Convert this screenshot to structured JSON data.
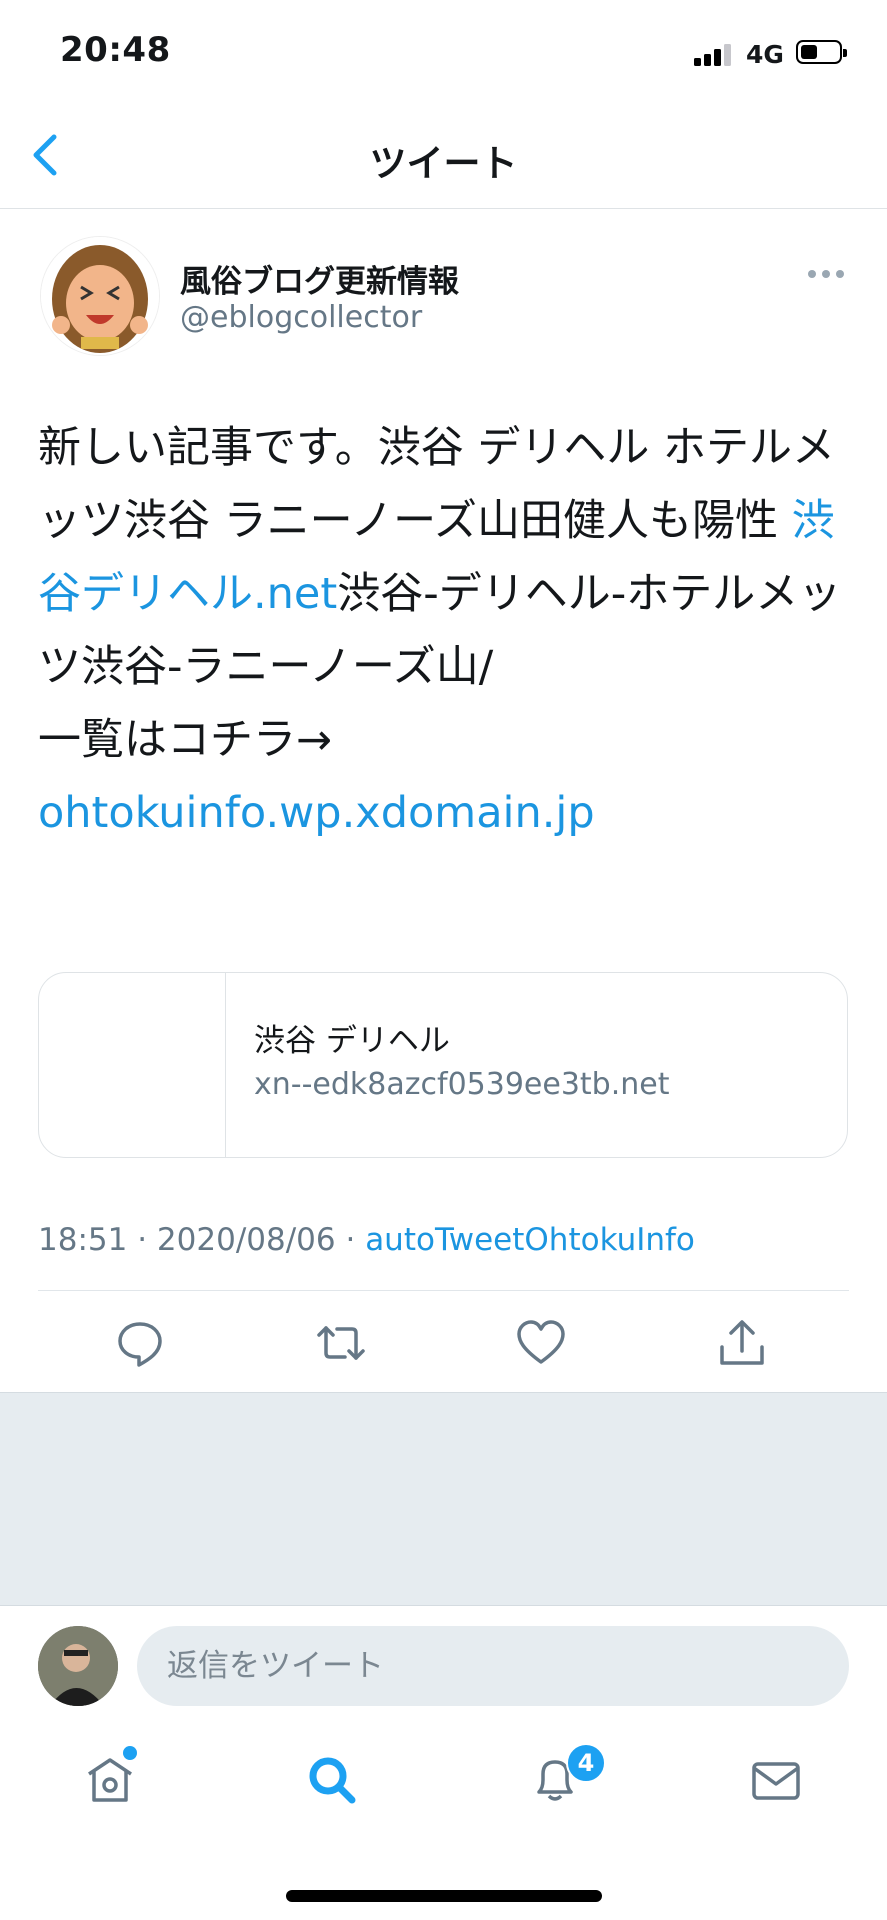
{
  "status_bar": {
    "time": "20:48",
    "network": "4G",
    "battery_level": 0.45
  },
  "header": {
    "title": "ツイート"
  },
  "tweet": {
    "author_name": "風俗ブログ更新情報",
    "author_handle": "@eblogcollector",
    "body": {
      "part1": "新しい記事です。渋谷 デリヘル ホテルメッツ渋谷 ラニーノーズ山田健人も陽性 ",
      "link1": "渋谷デリヘル.net",
      "part2": "渋谷-デリヘル-ホテルメッツ渋谷-ラニーノーズ山/",
      "part3": "一覧はコチラ→",
      "link2": "ohtokuinfo.wp.xdomain.jp"
    },
    "card": {
      "title": "渋谷 デリヘル",
      "domain": "xn--edk8azcf0539ee3tb.net"
    },
    "meta": {
      "time": "18:51",
      "separator": "·",
      "date": "2020/08/06",
      "source": "autoTweetOhtokuInfo"
    }
  },
  "reply": {
    "placeholder": "返信をツイート"
  },
  "tab_bar": {
    "notifications_badge": "4"
  },
  "colors": {
    "accent": "#1da1f2",
    "link": "#1b95e0",
    "secondary_text": "#657786",
    "gray_bg": "#e6ecf0"
  }
}
